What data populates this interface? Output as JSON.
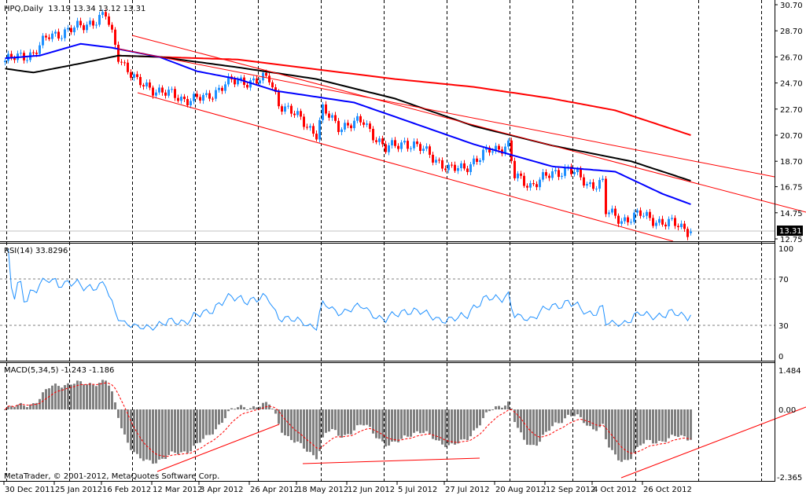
{
  "window": {
    "symbol_header": "HPQ,Daily  13.19 13.34 13.12 13.31",
    "copyright": "MetaTrader, © 2001-2012, MetaQuotes Software Corp."
  },
  "chart_data": [
    {
      "type": "candlestick",
      "title": "HPQ,Daily",
      "ohlc_last": {
        "open": 13.19,
        "high": 13.34,
        "low": 13.12,
        "close": 13.31
      },
      "current_price_label": "13.31",
      "y_ticks": [
        "30.70",
        "28.70",
        "26.70",
        "24.70",
        "22.70",
        "20.70",
        "18.70",
        "16.75",
        "14.75",
        "12.75"
      ],
      "y_tick_values": [
        30.7,
        28.7,
        26.7,
        24.7,
        22.7,
        20.7,
        18.7,
        16.75,
        14.75,
        12.75
      ],
      "ylim": [
        12.75,
        30.7
      ],
      "x_ticks": [
        "30 Dec 2011",
        "25 Jan 2012",
        "16 Feb 2012",
        "12 Mar 2012",
        "3 Apr 2012",
        "26 Apr 2012",
        "18 May 2012",
        "12 Jun 2012",
        "5 Jul 2012",
        "27 Jul 2012",
        "20 Aug 2012",
        "12 Sep 2012",
        "4 Oct 2012",
        "26 Oct 2012"
      ],
      "x_tick_bars": [
        0,
        16,
        31,
        47,
        62,
        78,
        93,
        109,
        125,
        140,
        156,
        172,
        187,
        203
      ],
      "close_keypoints_bar_price": [
        [
          0,
          26.4
        ],
        [
          9,
          27.0
        ],
        [
          14,
          28.3
        ],
        [
          24,
          29.0
        ],
        [
          32,
          29.9
        ],
        [
          36,
          26.8
        ],
        [
          42,
          24.7
        ],
        [
          56,
          23.5
        ],
        [
          64,
          23.5
        ],
        [
          70,
          24.7
        ],
        [
          84,
          25.0
        ],
        [
          87,
          23.2
        ],
        [
          95,
          21.7
        ],
        [
          99,
          20.8
        ],
        [
          101,
          22.6
        ],
        [
          106,
          21.4
        ],
        [
          114,
          21.7
        ],
        [
          121,
          19.6
        ],
        [
          127,
          20.2
        ],
        [
          135,
          19.3
        ],
        [
          141,
          18.0
        ],
        [
          146,
          18.3
        ],
        [
          151,
          18.9
        ],
        [
          154,
          19.6
        ],
        [
          160,
          19.9
        ],
        [
          162,
          17.5
        ],
        [
          167,
          16.9
        ],
        [
          174,
          17.7
        ],
        [
          179,
          18.2
        ],
        [
          185,
          16.9
        ],
        [
          190,
          17.1
        ],
        [
          191,
          14.8
        ],
        [
          196,
          14.2
        ],
        [
          202,
          14.6
        ],
        [
          209,
          14.0
        ],
        [
          214,
          13.8
        ],
        [
          218,
          13.31
        ]
      ],
      "moving_averages": [
        {
          "name": "MA red",
          "color": "#ff0000",
          "points_bar_price": [
            [
              36,
              26.8
            ],
            [
              74,
              26.5
            ],
            [
              104,
              25.6
            ],
            [
              124,
              25.0
            ],
            [
              149,
              24.4
            ],
            [
              174,
              23.5
            ],
            [
              194,
              22.6
            ],
            [
              218,
              20.7
            ]
          ]
        },
        {
          "name": "MA black",
          "color": "#000000",
          "points_bar_price": [
            [
              0,
              25.8
            ],
            [
              9,
              25.5
            ],
            [
              24,
              26.2
            ],
            [
              36,
              26.8
            ],
            [
              49,
              26.7
            ],
            [
              74,
              25.9
            ],
            [
              99,
              25.0
            ],
            [
              124,
              23.5
            ],
            [
              149,
              21.4
            ],
            [
              174,
              19.9
            ],
            [
              199,
              18.7
            ],
            [
              218,
              17.2
            ]
          ]
        },
        {
          "name": "MA blue",
          "color": "#0000ff",
          "points_bar_price": [
            [
              0,
              26.6
            ],
            [
              11,
              26.8
            ],
            [
              24,
              27.7
            ],
            [
              34,
              27.4
            ],
            [
              49,
              26.7
            ],
            [
              61,
              25.6
            ],
            [
              74,
              25.0
            ],
            [
              86,
              24.1
            ],
            [
              111,
              23.2
            ],
            [
              136,
              21.1
            ],
            [
              149,
              20.0
            ],
            [
              174,
              18.3
            ],
            [
              194,
              17.9
            ],
            [
              209,
              16.2
            ],
            [
              218,
              15.4
            ]
          ]
        }
      ],
      "colors": {
        "up": "#1e90ff",
        "down": "#ff0000",
        "channel": "#ff0000"
      }
    },
    {
      "type": "line",
      "title": "RSI(14) 33.8296",
      "y_ticks": [
        "100",
        "70",
        "30",
        "0"
      ],
      "levels": [
        70,
        30
      ],
      "ylim": [
        0,
        100
      ],
      "last_value": 33.8296,
      "color": "#1e90ff"
    },
    {
      "type": "bar",
      "title": "MACD(5,34,5) -1.243 -1.186",
      "y_ticks": [
        "1.484",
        "0.00",
        "-2.365"
      ],
      "ylim": [
        -2.365,
        1.484
      ],
      "histogram_color": "#808080",
      "signal_color": "#ff0000"
    }
  ]
}
